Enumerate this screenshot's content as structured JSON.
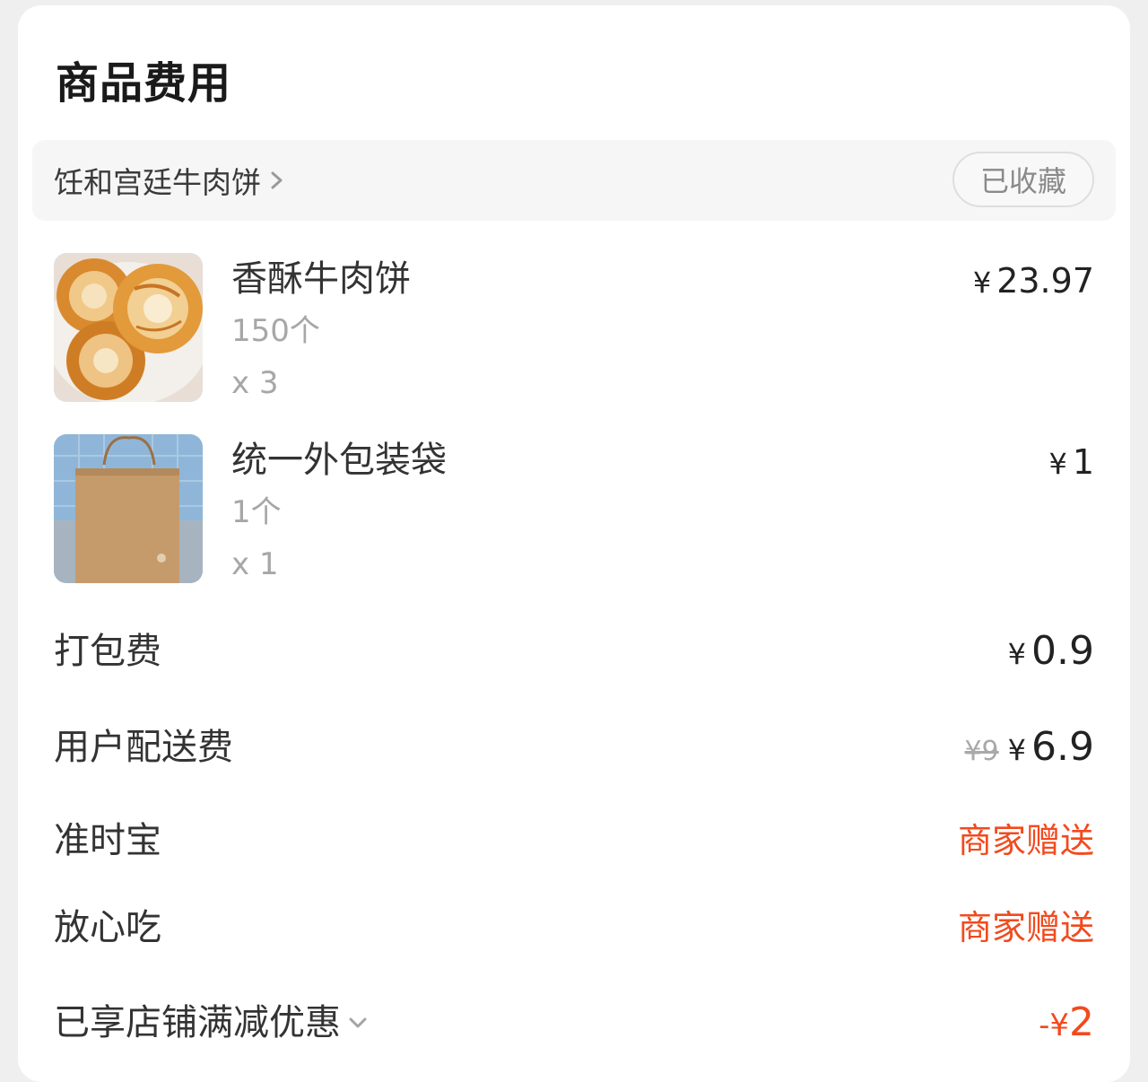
{
  "section_title": "商品费用",
  "store": {
    "name": "饪和宫廷牛肉饼",
    "favorite_label": "已收藏"
  },
  "items": [
    {
      "name": "香酥牛肉饼",
      "spec": "150个",
      "qty": "x 3",
      "currency": "¥",
      "price": "23.97",
      "image_icon": "beef-pie-photo"
    },
    {
      "name": "统一外包装袋",
      "spec": "1个",
      "qty": "x 1",
      "currency": "¥",
      "price": "1",
      "image_icon": "paper-bag-photo"
    }
  ],
  "fees": {
    "packing": {
      "label": "打包费",
      "currency": "¥",
      "amount": "0.9"
    },
    "delivery": {
      "label": "用户配送费",
      "original": "¥9",
      "currency": "¥",
      "amount": "6.9"
    },
    "on_time": {
      "label": "准时宝",
      "value": "商家赠送"
    },
    "safe_eat": {
      "label": "放心吃",
      "value": "商家赠送"
    },
    "discount": {
      "label": "已享店铺满减优惠",
      "prefix": "-¥",
      "amount": "2"
    }
  },
  "colors": {
    "accent_red": "#f24a1e",
    "text_primary": "#222222",
    "text_muted": "#a7a7a7",
    "card_bg": "#ffffff",
    "page_bg": "#efefef"
  }
}
